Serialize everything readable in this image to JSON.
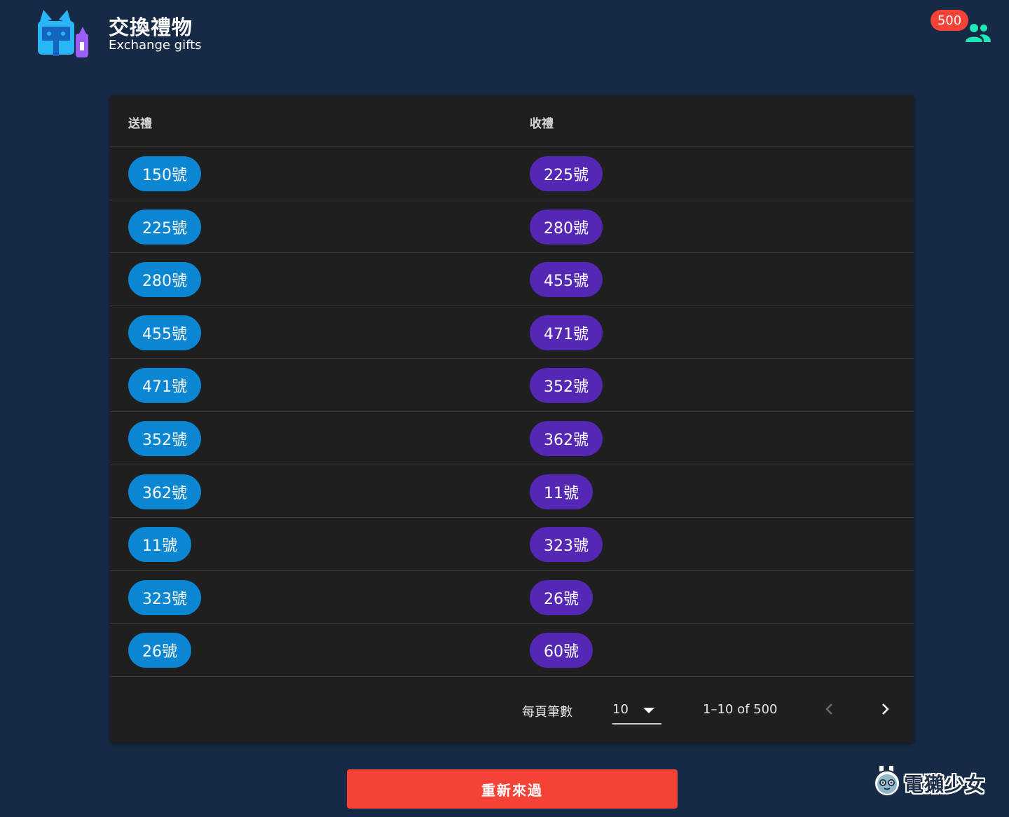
{
  "header": {
    "title": "交換禮物",
    "subtitle": "Exchange gifts",
    "participant_count": "500",
    "logo_icon": "cat-gift-logo-icon",
    "users_icon": "users-group-icon"
  },
  "table": {
    "columns": {
      "send": "送禮",
      "receive": "收禮"
    },
    "rows": [
      {
        "send": "150號",
        "receive": "225號"
      },
      {
        "send": "225號",
        "receive": "280號"
      },
      {
        "send": "280號",
        "receive": "455號"
      },
      {
        "send": "455號",
        "receive": "471號"
      },
      {
        "send": "471號",
        "receive": "352號"
      },
      {
        "send": "352號",
        "receive": "362號"
      },
      {
        "send": "362號",
        "receive": "11號"
      },
      {
        "send": "11號",
        "receive": "323號"
      },
      {
        "send": "323號",
        "receive": "26號"
      },
      {
        "send": "26號",
        "receive": "60號"
      }
    ],
    "pagination": {
      "rows_per_page_label": "每頁筆數",
      "rows_per_page": "10",
      "range": "1–10 of 500"
    }
  },
  "actions": {
    "restart_label": "重新來過"
  },
  "watermark": {
    "text": "電獺少女"
  },
  "colors": {
    "background": "#172a45",
    "card": "#1f1f1f",
    "send_chip": "#0a86d2",
    "receive_chip": "#5427b5",
    "accent_red": "#f44336",
    "users_icon": "#1de9b6"
  }
}
